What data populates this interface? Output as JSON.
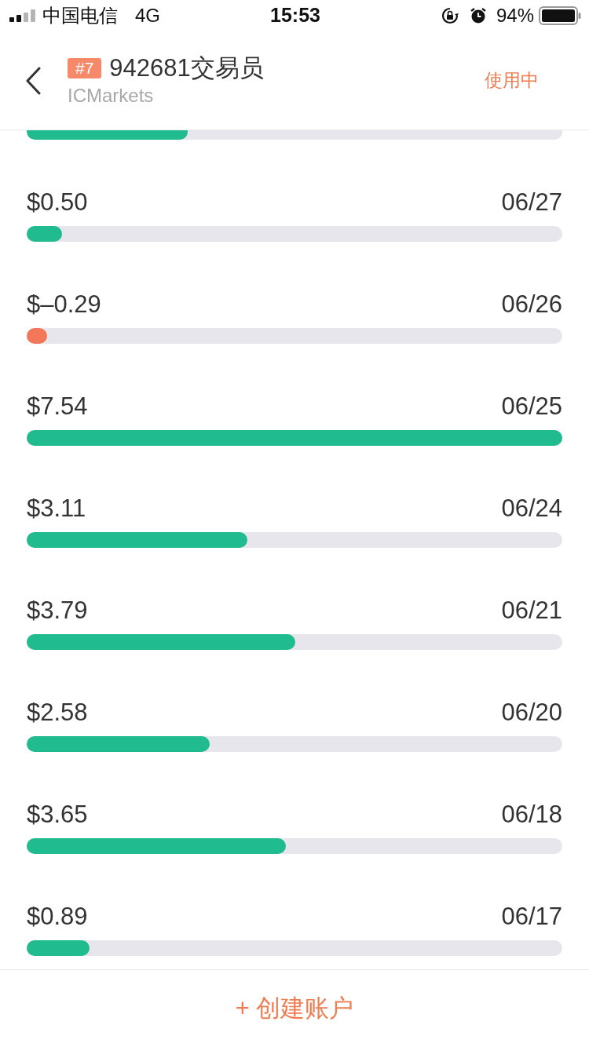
{
  "status_bar": {
    "carrier": "中国电信",
    "network": "4G",
    "time": "15:53",
    "battery": "94%"
  },
  "header": {
    "badge": "#7",
    "title": "942681交易员",
    "subtitle": "ICMarkets",
    "status": "使用中"
  },
  "days": [
    {
      "level": 0.3,
      "color": "#20bb8f"
    },
    {
      "amount": "$0.50",
      "date": "06/27",
      "level": 0.066,
      "color": "#20bb8f"
    },
    {
      "amount": "$–0.29",
      "date": "06/26",
      "level": 0.038,
      "color": "#f4775a"
    },
    {
      "amount": "$7.54",
      "date": "06/25",
      "level": 1,
      "color": "#20bb8f"
    },
    {
      "amount": "$3.11",
      "date": "06/24",
      "level": 0.412,
      "color": "#20bb8f"
    },
    {
      "amount": "$3.79",
      "date": "06/21",
      "level": 0.501,
      "color": "#20bb8f"
    },
    {
      "amount": "$2.58",
      "date": "06/20",
      "level": 0.342,
      "color": "#20bb8f"
    },
    {
      "amount": "$3.65",
      "date": "06/18",
      "level": 0.484,
      "color": "#20bb8f"
    },
    {
      "amount": "$0.89",
      "date": "06/17",
      "level": 0.117,
      "color": "#20bb8f"
    }
  ],
  "footer": {
    "button": "+ 创建账户"
  }
}
